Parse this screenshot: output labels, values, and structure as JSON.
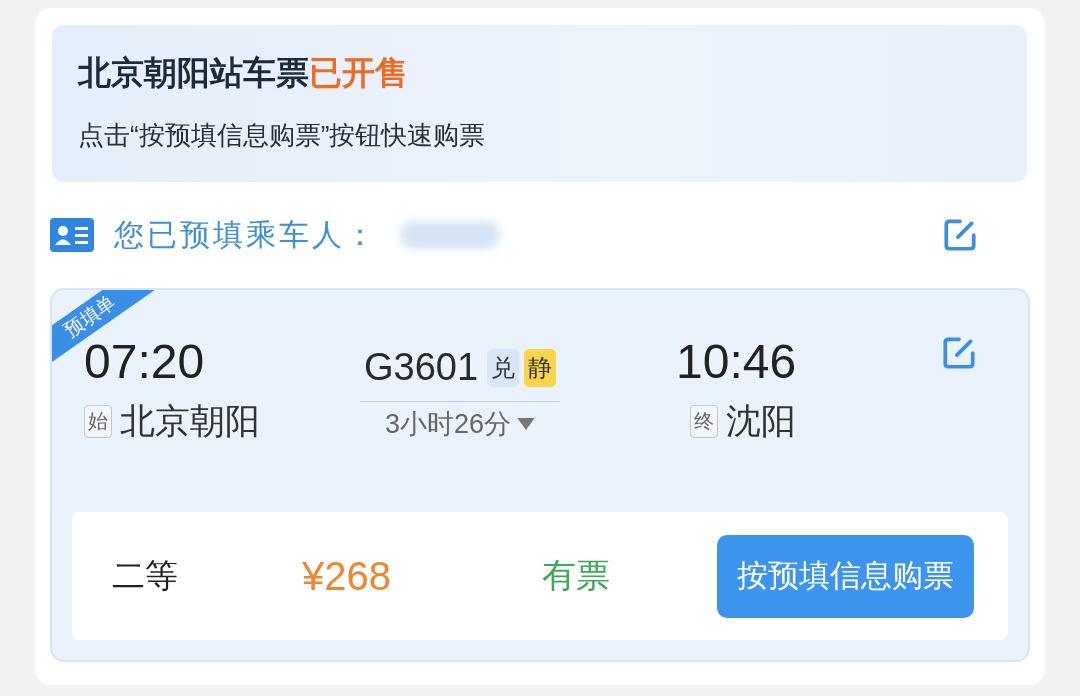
{
  "banner": {
    "title": "北京朝阳站车票",
    "title_highlight": "已开售",
    "subtitle": "点击“按预填信息购票”按钮快速购票"
  },
  "passenger": {
    "label": "您已预填乘车人："
  },
  "ticket": {
    "ribbon": "预填单",
    "departure": {
      "time": "07:20",
      "tag": "始",
      "station": "北京朝阳"
    },
    "train": {
      "number": "G3601",
      "tags": [
        {
          "text": "兑",
          "color": "#d6e6f7"
        },
        {
          "text": "静",
          "color": "#f9d54a"
        }
      ],
      "duration": "3小时26分"
    },
    "arrival": {
      "time": "10:46",
      "tag": "终",
      "station": "沈阳"
    },
    "seat": {
      "class": "二等",
      "price": "¥268",
      "availability": "有票",
      "button": "按预填信息购票"
    }
  }
}
